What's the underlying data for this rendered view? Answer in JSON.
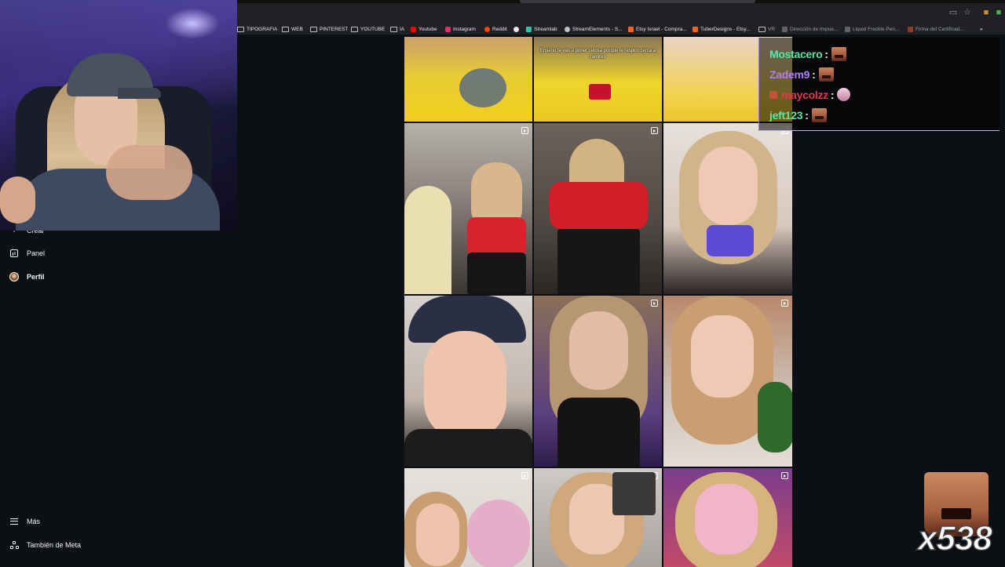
{
  "browser": {
    "bookmarks": [
      {
        "label": "TIPOGRAFIA",
        "icon": "folder-icon"
      },
      {
        "label": "WEB",
        "icon": "folder-icon"
      },
      {
        "label": "PINTEREST",
        "icon": "folder-icon"
      },
      {
        "label": "YOUTUBE",
        "icon": "folder-icon"
      },
      {
        "label": "IA",
        "icon": "folder-icon"
      },
      {
        "label": "Youtube",
        "icon": "youtube-icon",
        "color": "#ff0000"
      },
      {
        "label": "Instagram",
        "icon": "instagram-icon",
        "color": "#e1306c"
      },
      {
        "label": "Reddit",
        "icon": "reddit-icon",
        "color": "#ff4500"
      },
      {
        "label": "",
        "icon": "github-icon",
        "color": "#e8eaed"
      },
      {
        "label": "Streamlab",
        "icon": "streamlabs-icon",
        "color": "#31c3a2"
      },
      {
        "label": "StreamElements - S...",
        "icon": "streamelements-icon",
        "color": "#bdc1c6"
      },
      {
        "label": "Etsy Israel - Compra...",
        "icon": "etsy-icon",
        "color": "#f1641e"
      },
      {
        "label": "TuberDesigns - Etsy...",
        "icon": "etsy-icon",
        "color": "#f1641e"
      },
      {
        "label": "VR",
        "icon": "folder-icon",
        "dim": true
      },
      {
        "label": "Dirección de Impue...",
        "icon": "page-icon",
        "dim": true
      },
      {
        "label": "Liquid Freckle Pen...",
        "icon": "page-icon",
        "dim": true
      },
      {
        "label": "Firma del Certificad...",
        "icon": "page-icon",
        "dim": true
      }
    ],
    "more_bookmarks": "»"
  },
  "sidebar": {
    "items": [
      {
        "label": "Crear",
        "icon": "plus-icon"
      },
      {
        "label": "Panel",
        "icon": "panel-icon"
      },
      {
        "label": "Perfil",
        "icon": "avatar-icon",
        "bold": true
      }
    ],
    "bottom_items": [
      {
        "label": "Más",
        "icon": "menu-icon"
      },
      {
        "label": "También de Meta",
        "icon": "meta-icon"
      }
    ]
  },
  "grid": {
    "caption": "Enserio te vas a poner celosa porque le respiro cerca a ramires",
    "rows": 4,
    "cols": 3
  },
  "chat": {
    "messages": [
      {
        "user": "Mostacero",
        "color": "#5fe3a1",
        "separator": ":",
        "emote": "laugh-emote"
      },
      {
        "user": "Zadem9",
        "color": "#b07cf2",
        "separator": ":",
        "emote": "laugh-emote"
      },
      {
        "user": "maycolzz",
        "color": "#e8364f",
        "separator": ":",
        "emote": "pink-emote",
        "badge": true
      },
      {
        "user": "jeft123",
        "color": "#5fe3a1",
        "separator": ":",
        "emote": "laugh-emote"
      }
    ]
  },
  "overlay": {
    "multiplier": "x538"
  },
  "colors": {
    "background": "#0c1014",
    "chrome": "#202124"
  }
}
